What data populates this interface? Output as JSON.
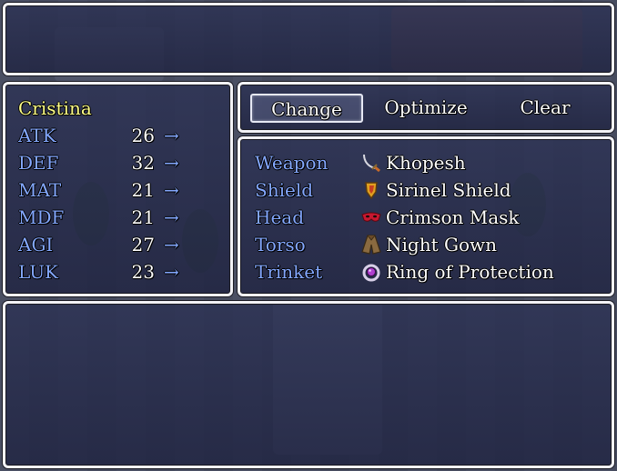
{
  "actor": {
    "name": "Cristina"
  },
  "params": [
    {
      "label": "ATK",
      "value": "26",
      "arrow": "→"
    },
    {
      "label": "DEF",
      "value": "32",
      "arrow": "→"
    },
    {
      "label": "MAT",
      "value": "21",
      "arrow": "→"
    },
    {
      "label": "MDF",
      "value": "21",
      "arrow": "→"
    },
    {
      "label": "AGI",
      "value": "27",
      "arrow": "→"
    },
    {
      "label": "LUK",
      "value": "23",
      "arrow": "→"
    }
  ],
  "commands": {
    "change": "Change",
    "optimize": "Optimize",
    "clear": "Clear"
  },
  "slots": [
    {
      "slot": "Weapon",
      "item": "Khopesh",
      "icon": "sword-icon"
    },
    {
      "slot": "Shield",
      "item": "Sirinel Shield",
      "icon": "shield-icon"
    },
    {
      "slot": "Head",
      "item": "Crimson Mask",
      "icon": "mask-icon"
    },
    {
      "slot": "Torso",
      "item": "Night Gown",
      "icon": "robe-icon"
    },
    {
      "slot": "Trinket",
      "item": "Ring of Protection",
      "icon": "ring-icon"
    }
  ],
  "help": {
    "text": ""
  },
  "colors": {
    "system": "#84a8ff",
    "actor_name": "#ffff88",
    "text": "#ffffff"
  }
}
